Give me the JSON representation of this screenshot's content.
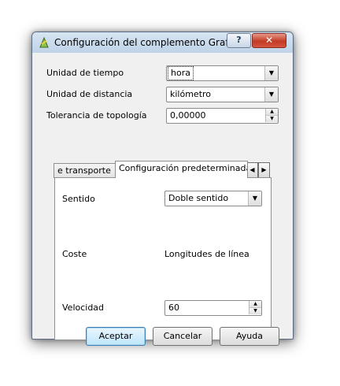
{
  "window": {
    "title": "Configuración del complemento Grafos...",
    "help_label": "?",
    "close_label": "✕"
  },
  "form": {
    "time_unit_label": "Unidad de tiempo",
    "time_unit_value": "hora",
    "distance_unit_label": "Unidad de distancia",
    "distance_unit_value": "kilómetro",
    "topology_tolerance_label": "Tolerancia de topología",
    "topology_tolerance_value": "0,00000"
  },
  "tabs": [
    {
      "label": "e transporte"
    },
    {
      "label": "Configuración predeterminada"
    }
  ],
  "tab_pane": {
    "direction_label": "Sentido",
    "direction_value": "Doble sentido",
    "cost_label": "Coste",
    "cost_value": "Longitudes de línea",
    "speed_label": "Velocidad",
    "speed_value": "60"
  },
  "buttons": {
    "accept": "Aceptar",
    "cancel": "Cancelar",
    "help": "Ayuda"
  },
  "glyphs": {
    "dropdown": "▼",
    "up": "▲",
    "down": "▼",
    "left": "◀",
    "right": "▶"
  }
}
